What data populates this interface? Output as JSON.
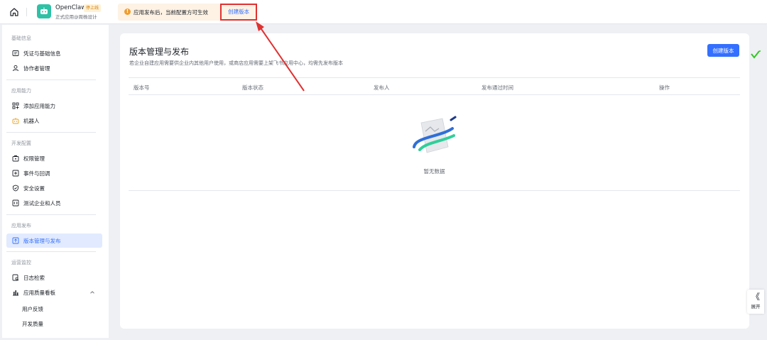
{
  "topbar": {
    "app_name": "OpenClaw",
    "app_badge": "停上线",
    "app_sub": "正式应用@周杨设计",
    "notice_text": "应用发布后，当前配置方可生效",
    "notice_link": "创建版本"
  },
  "sidebar": {
    "sections": {
      "basic": "基础信息",
      "ability": "应用能力",
      "dev": "开发配置",
      "publish": "应用发布",
      "ops": "运营监控"
    },
    "items": {
      "credentials": "凭证与基础信息",
      "collaborators": "协作者管理",
      "add_ability": "添加应用能力",
      "bot": "机器人",
      "permissions": "权限管理",
      "events": "事件与回调",
      "security": "安全设置",
      "test_enterprise": "测试企业和人员",
      "version_mgmt": "版本管理与发布",
      "logs": "日志检索",
      "quality": "应用质量看板",
      "feedback": "用户反馈",
      "dev_quality": "开发质量"
    }
  },
  "main": {
    "title": "版本管理与发布",
    "description": "若企业自建应用需要供企业内其他用户使用，或商店应用需要上架飞书应用中心，均需先发布版本",
    "create_button": "创建版本",
    "columns": [
      "版本号",
      "版本状态",
      "发布人",
      "发布通过时间",
      "操作"
    ],
    "empty_text": "暂无数据"
  },
  "right_panel": {
    "expand_label": "展开",
    "chevron": "《"
  },
  "colors": {
    "accent": "#3370ff",
    "annotation": "#e03131",
    "notice_bg": "#fdf2e4"
  }
}
